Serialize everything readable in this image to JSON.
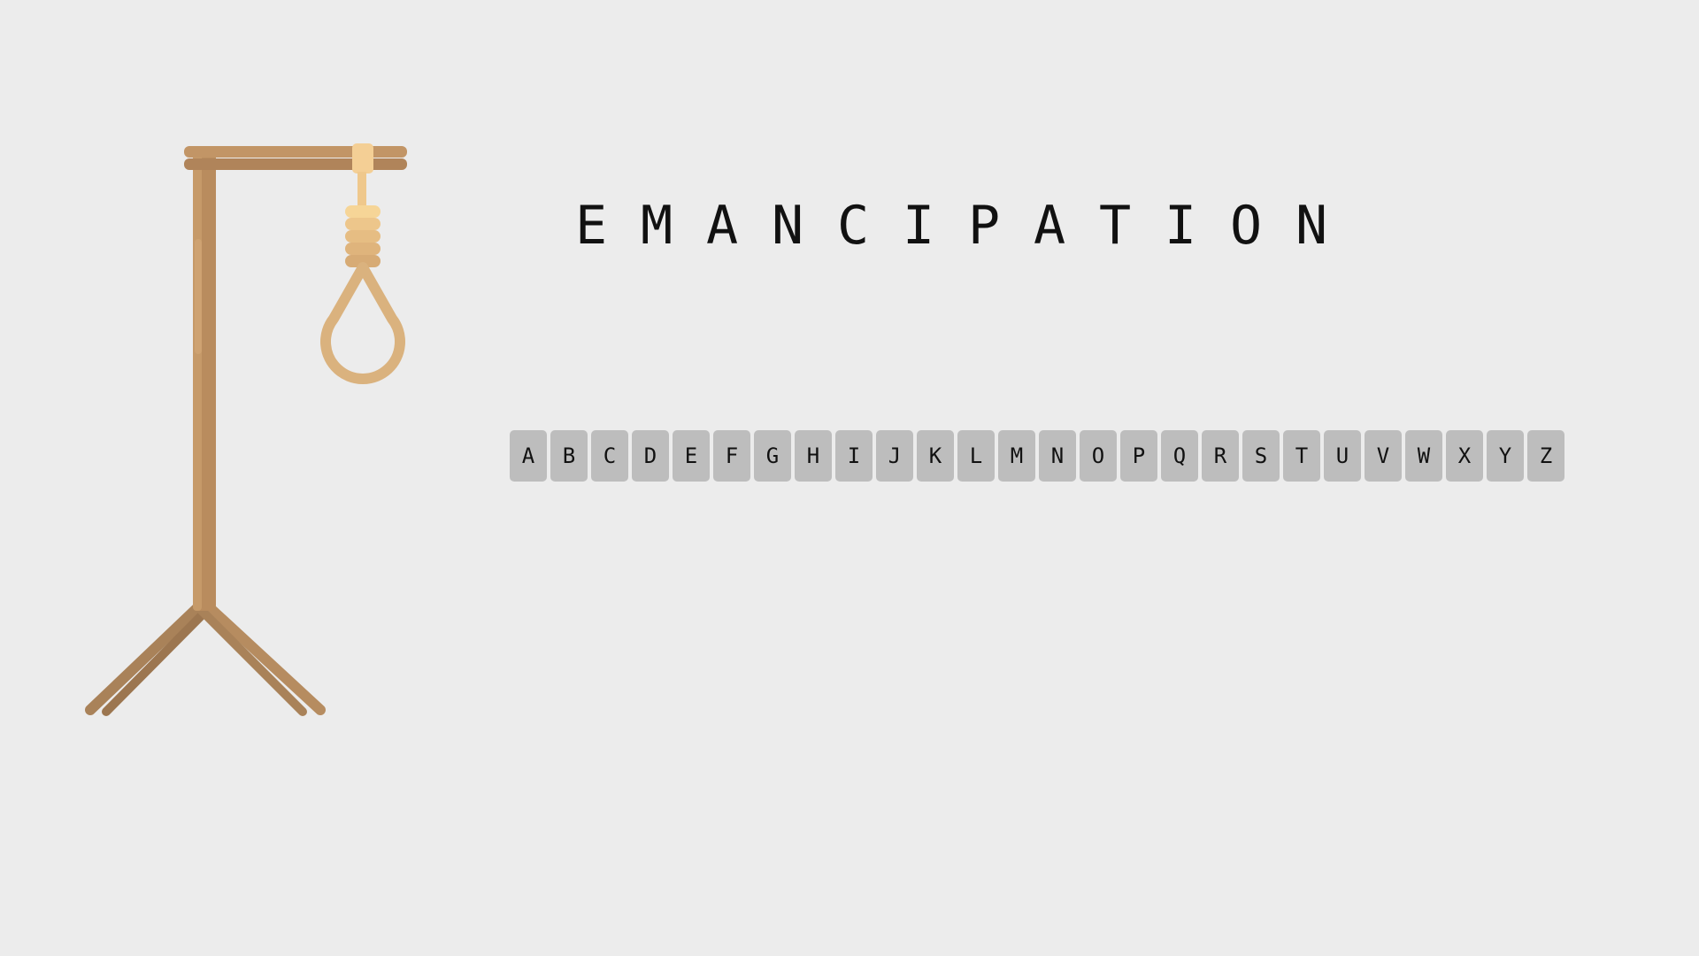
{
  "word": {
    "letters": [
      "E",
      "M",
      "A",
      "N",
      "C",
      "I",
      "P",
      "A",
      "T",
      "I",
      "O",
      "N"
    ]
  },
  "keyboard": {
    "keys": [
      "A",
      "B",
      "C",
      "D",
      "E",
      "F",
      "G",
      "H",
      "I",
      "J",
      "K",
      "L",
      "M",
      "N",
      "O",
      "P",
      "Q",
      "R",
      "S",
      "T",
      "U",
      "V",
      "W",
      "X",
      "Y",
      "Z"
    ]
  },
  "colors": {
    "background": "#ececec",
    "key_background": "#bdbdbd",
    "wood": "#b98c5e",
    "rope": "#e1b884"
  }
}
